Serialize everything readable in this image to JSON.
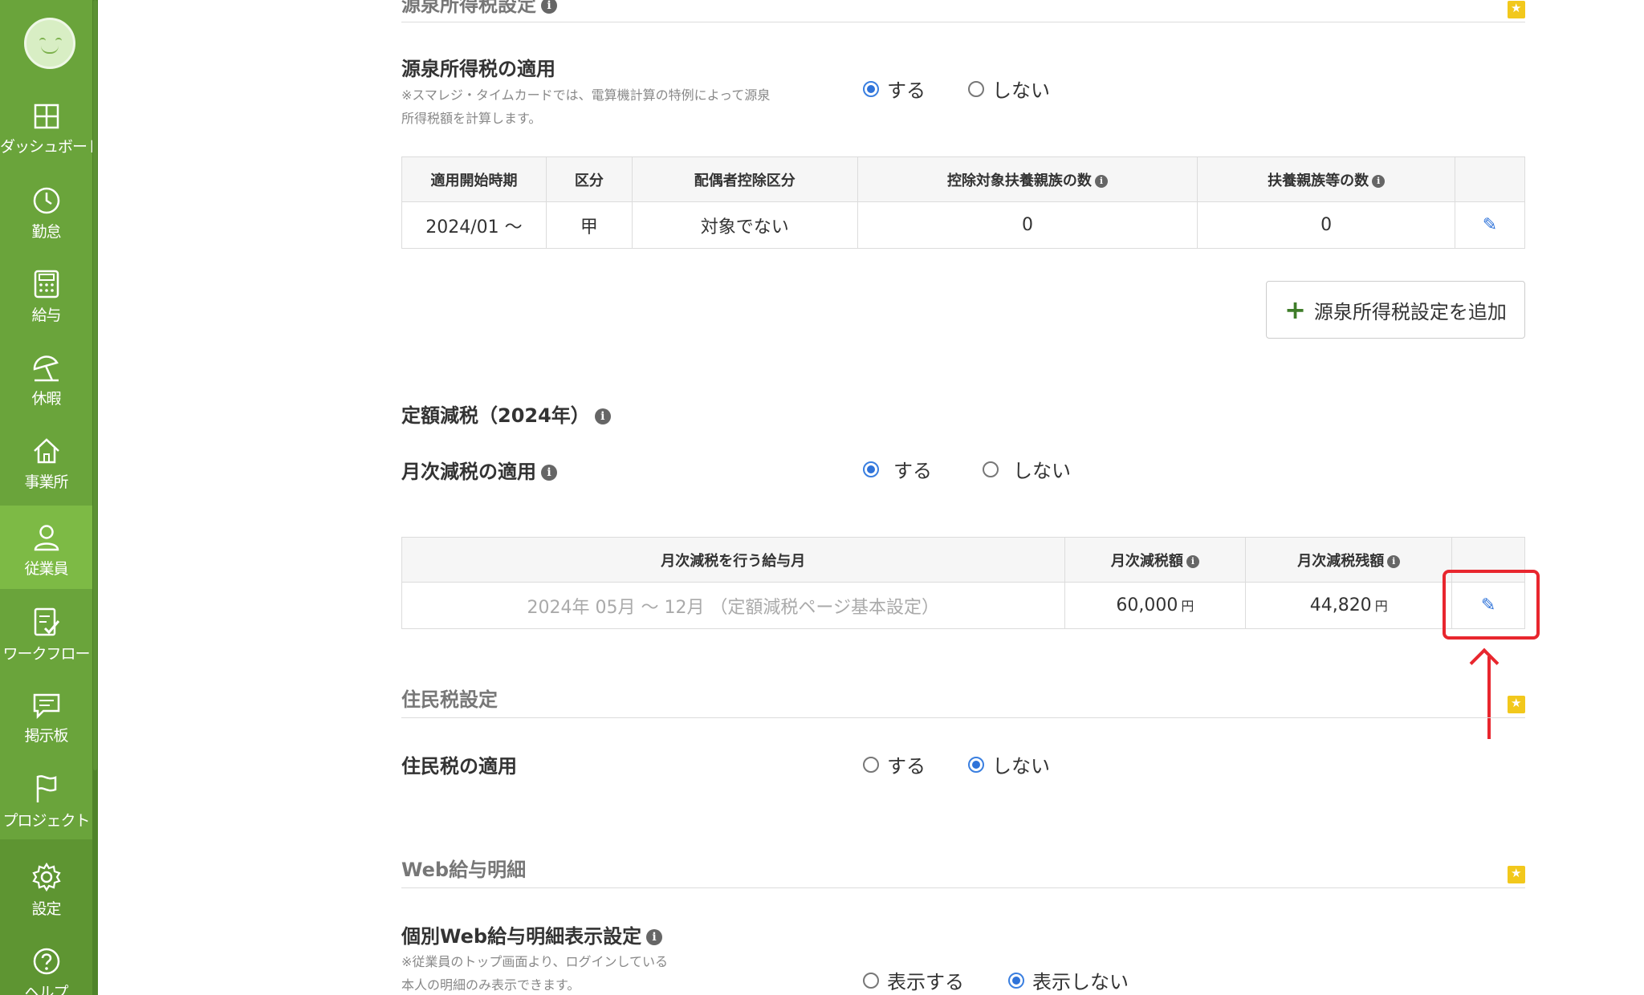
{
  "sidebar": {
    "items": [
      {
        "label": "ダッシュボード",
        "icon": "dashboard-icon"
      },
      {
        "label": "勤怠",
        "icon": "clock-icon"
      },
      {
        "label": "給与",
        "icon": "calculator-icon"
      },
      {
        "label": "休暇",
        "icon": "beach-umbrella-icon"
      },
      {
        "label": "事業所",
        "icon": "house-icon"
      },
      {
        "label": "従業員",
        "icon": "person-icon"
      },
      {
        "label": "ワークフロー",
        "icon": "checklist-icon"
      },
      {
        "label": "掲示板",
        "icon": "chat-bubble-icon"
      },
      {
        "label": "プロジェクト",
        "icon": "flag-icon"
      },
      {
        "label": "設定",
        "icon": "gear-icon"
      },
      {
        "label": "ヘルプ",
        "icon": "help-icon"
      }
    ],
    "active_item": "従業員",
    "colors": {
      "bg": "#6aa43b",
      "active": "#7dba45"
    }
  },
  "withholding": {
    "section_title": "源泉所得税設定",
    "apply_label": "源泉所得税の適用",
    "note_line1": "※スマレジ・タイムカードでは、電算機計算の特例によって源泉",
    "note_line2": "所得税額を計算します。",
    "options": [
      "する",
      "しない"
    ],
    "selected": "する",
    "table": {
      "headers": [
        "適用開始時期",
        "区分",
        "配偶者控除区分",
        "控除対象扶養親族の数",
        "扶養親族等の数",
        ""
      ],
      "rows": [
        {
          "start": "2024/01 〜",
          "category": "甲",
          "spouse": "対象でない",
          "dependents": "0",
          "family": "0"
        }
      ]
    },
    "add_button": "源泉所得税設定を追加"
  },
  "flat_tax": {
    "title": "定額減税（2024年）",
    "apply_label": "月次減税の適用",
    "options": [
      "する",
      "しない"
    ],
    "selected": "する",
    "table": {
      "headers": [
        "月次減税を行う給与月",
        "月次減税額",
        "月次減税残額",
        ""
      ],
      "rows": [
        {
          "months": "2024年 05月 〜 12月 （定額減税ページ基本設定）",
          "amount": "60,000",
          "remaining": "44,820",
          "unit": "円"
        }
      ]
    }
  },
  "resident_tax": {
    "section_title": "住民税設定",
    "apply_label": "住民税の適用",
    "options": [
      "する",
      "しない"
    ],
    "selected": "しない"
  },
  "web_payslip": {
    "section_title": "Web給与明細",
    "setting_label": "個別Web給与明細表示設定",
    "note_line1": "※従業員のトップ画面より、ログインしている",
    "note_line2": "本人の明細のみ表示できます。",
    "options": [
      "表示する",
      "表示しない"
    ],
    "selected": "表示しない"
  },
  "colors": {
    "accent_blue": "#2f73d9",
    "highlight_red": "#e8262e",
    "star": "#f2c81c"
  }
}
